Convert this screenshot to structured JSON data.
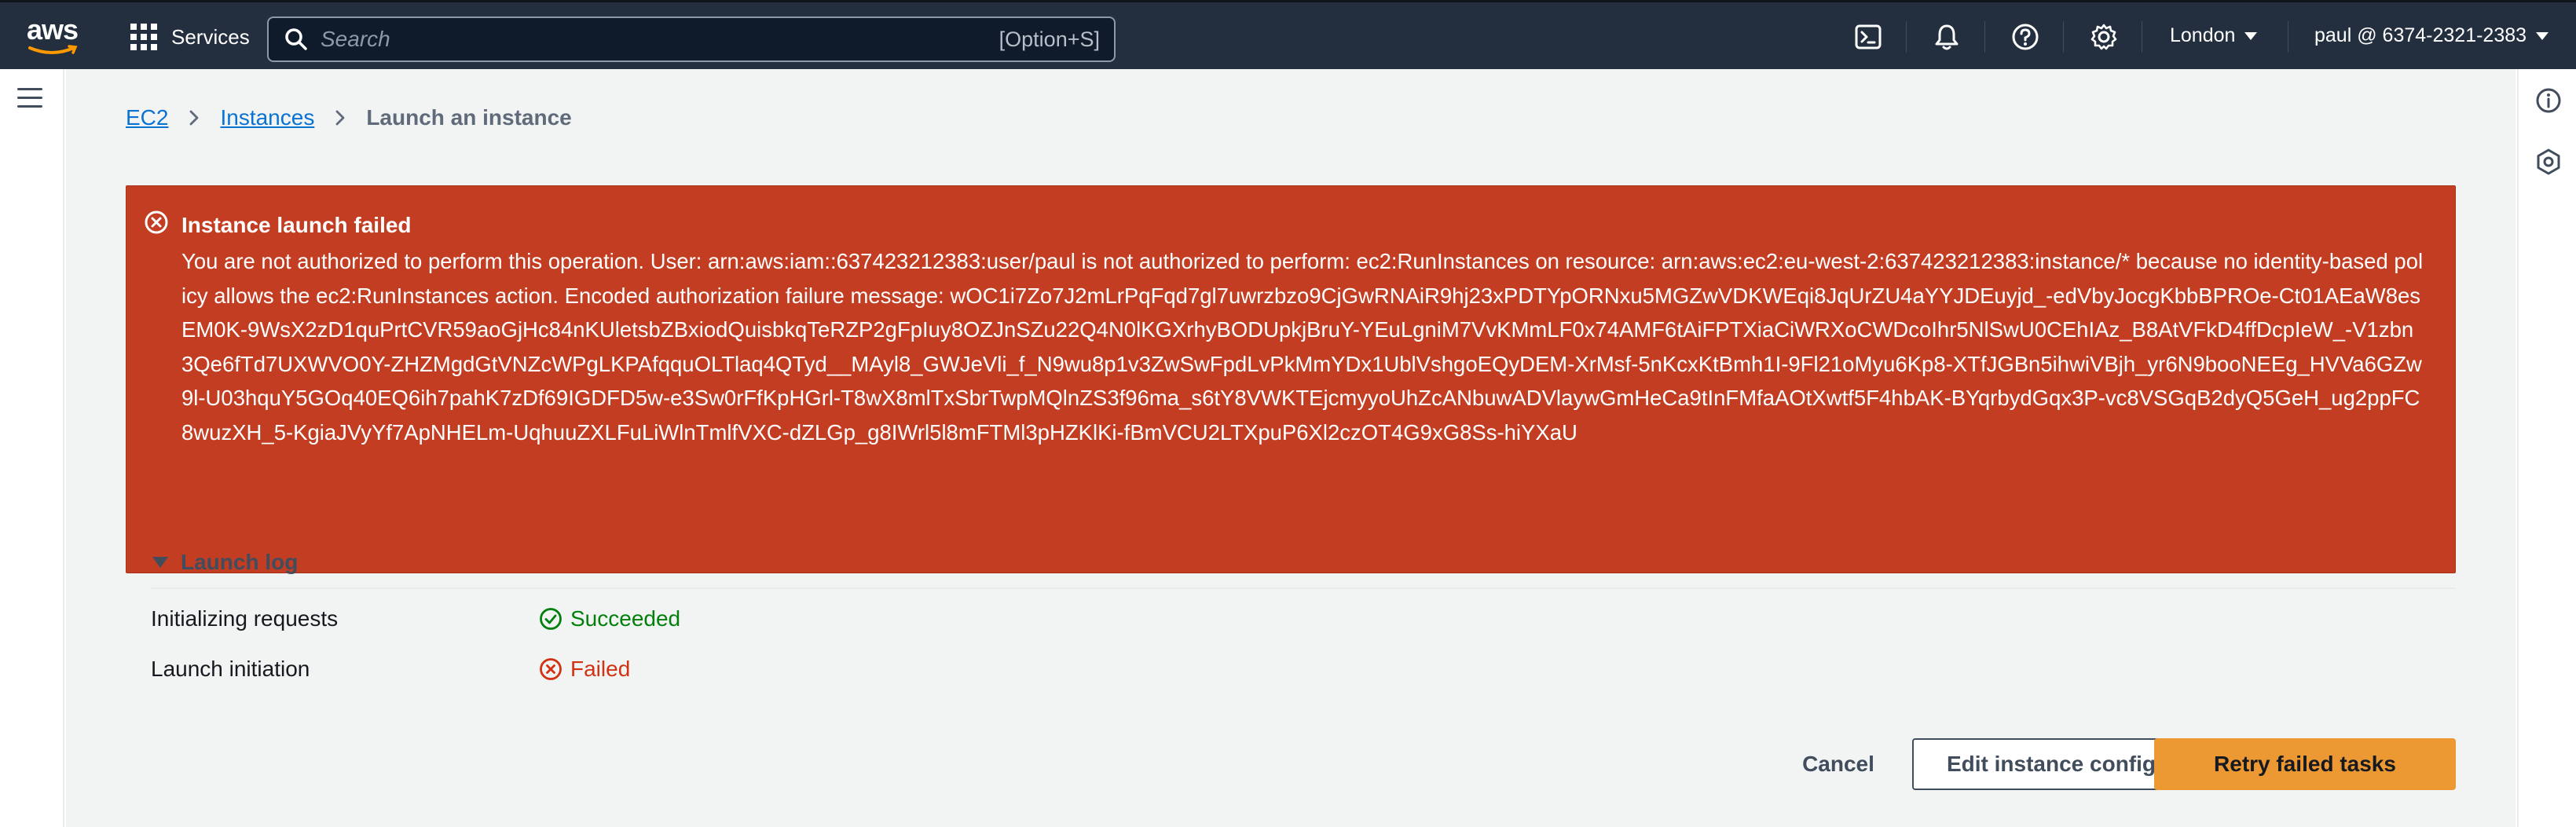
{
  "topnav": {
    "logo_text": "aws",
    "services_label": "Services",
    "search": {
      "placeholder": "Search",
      "shortcut": "[Option+S]"
    },
    "region": "London",
    "account": "paul @ 6374-2321-2383"
  },
  "breadcrumb": {
    "items": [
      {
        "label": "EC2"
      },
      {
        "label": "Instances"
      },
      {
        "label": "Launch an instance"
      }
    ]
  },
  "alert": {
    "title": "Instance launch failed",
    "message": "You are not authorized to perform this operation. User: arn:aws:iam::637423212383:user/paul is not authorized to perform: ec2:RunInstances on resource: arn:aws:ec2:eu-west-2:637423212383:instance/* because no identity-based policy allows the ec2:RunInstances action. Encoded authorization failure message: wOC1i7Zo7J2mLrPqFqd7gl7uwrzbzo9CjGwRNAiR9hj23xPDTYpORNxu5MGZwVDKWEqi8JqUrZU4aYYJDEuyjd_-edVbyJocgKbbBPROe-Ct01AEaW8esEM0K-9WsX2zD1quPrtCVR59aoGjHc84nKUletsbZBxiodQuisbkqTeRZP2gFpIuy8OZJnSZu22Q4N0lKGXrhyBODUpkjBruY-YEuLgniM7VvKMmLF0x74AMF6tAiFPTXiaCiWRXoCWDcoIhr5NlSwU0CEhIAz_B8AtVFkD4ffDcpIeW_-V1zbn3Qe6fTd7UXWVO0Y-ZHZMgdGtVNZcWPgLKPAfqquOLTlaq4QTyd__MAyl8_GWJeVli_f_N9wu8p1v3ZwSwFpdLvPkMmYDx1UblVshgoEQyDEM-XrMsf-5nKcxKtBmh1I-9Fl21oMyu6Kp8-XTfJGBn5ihwiVBjh_yr6N9booNEEg_HVVa6GZw9l-U03hquY5GOq40EQ6ih7pahK7zDf69IGDFD5w-e3Sw0rFfKpHGrl-T8wX8mlTxSbrTwpMQlnZS3f96ma_s6tY8VWKTEjcmyyoUhZcANbuwADVlaywGmHeCa9tInFMfaAOtXwtf5F4hbAK-BYqrbydGqx3P-vc8VSGqB2dyQ5GeH_ug2ppFC8wuzXH_5-KgiaJVyYf7ApNHELm-UqhuuZXLFuLiWlnTmlfVXC-dZLGp_g8IWrl5l8mFTMl3pHZKlKi-fBmVCU2LTXpuP6Xl2czOT4G9xG8Ss-hiYXaU"
  },
  "launch_log": {
    "title": "Launch log",
    "rows": [
      {
        "label": "Initializing requests",
        "status": "Succeeded",
        "state": "success"
      },
      {
        "label": "Launch initiation",
        "status": "Failed",
        "state": "error"
      }
    ]
  },
  "actions": {
    "cancel": "Cancel",
    "edit": "Edit instance config",
    "retry": "Retry failed tasks"
  },
  "colors": {
    "nav_bg": "#232f3e",
    "alert_bg": "#c23d22",
    "link": "#0972d3",
    "success": "#037f0c",
    "error": "#d13212",
    "primary_button": "#ec9933"
  }
}
